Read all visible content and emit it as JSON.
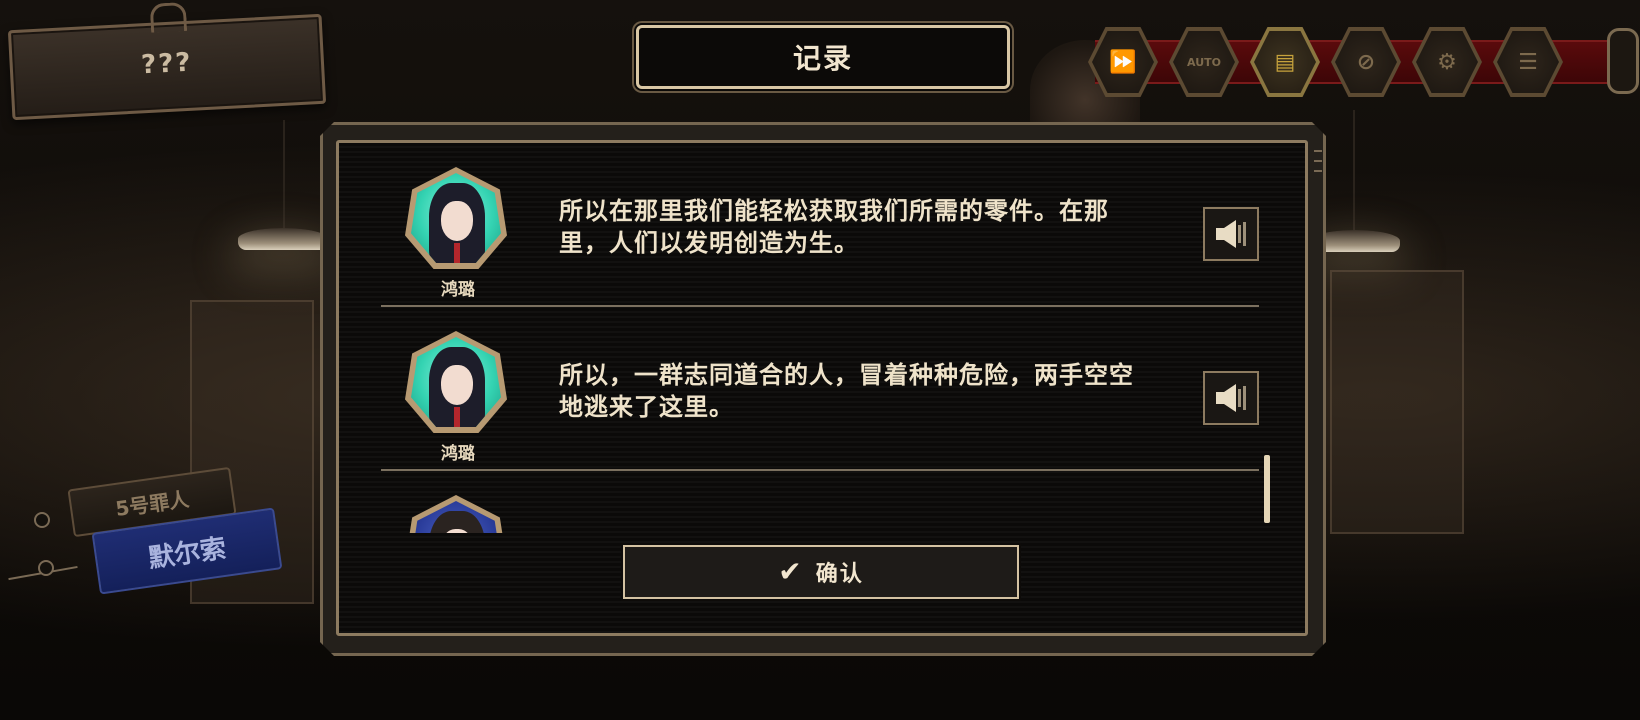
{
  "top_left_plate": {
    "label": "???"
  },
  "dialog": {
    "title": "记录",
    "confirm_label": "确认"
  },
  "toolbar": {
    "buttons": [
      {
        "icon": "fast-forward-icon",
        "label": ""
      },
      {
        "icon": "auto-icon",
        "label": "AUTO"
      },
      {
        "icon": "log-icon",
        "label": ""
      },
      {
        "icon": "hide-ui-icon",
        "label": ""
      },
      {
        "icon": "gear-icon",
        "label": ""
      },
      {
        "icon": "menu-icon",
        "label": ""
      }
    ]
  },
  "left_tags": {
    "sinner_label": "5号罪人",
    "name_label": "默尔索"
  },
  "log_entries": [
    {
      "speaker": "鸿璐",
      "text": "所以在那里我们能轻松获取我们所需的零件。在那里，人们以发明创造为生。"
    },
    {
      "speaker": "鸿璐",
      "text": "所以，一群志同道合的人，冒着种种危险，两手空空地逃来了这里。"
    }
  ],
  "colors": {
    "frame": "#d4c2a2",
    "ribbon": "#5a0a0c",
    "avatar_teal": "#34d3b2",
    "avatar_blue": "#2a3c9a",
    "name_tag_blue": "#1f2d73"
  }
}
